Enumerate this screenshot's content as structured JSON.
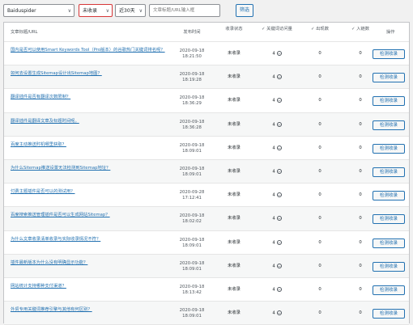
{
  "filters": {
    "spider": "Baiduspider",
    "status": "未收录",
    "period": "近30天",
    "search_placeholder": "文章标题/URL输入框",
    "filter_label": "筛选"
  },
  "table": {
    "headers": {
      "title": "文章标题/URL",
      "date": "发布时间",
      "status": "收录状态",
      "keywords": "✓ 关键词访问量",
      "hits": "✓ 出现数",
      "indexed": "✓ 入链数",
      "action": "操作"
    },
    "rows": [
      {
        "title": "国内是否可以使用Smart Keywords Tool（Pro版本）的谷歌热门关键词排名呢？",
        "date": "2020-09-18",
        "time": "18:21:50",
        "status": "未收录",
        "kw": "4",
        "hits": "0",
        "ind": "0",
        "action": "检测收录"
      },
      {
        "title": "如何去设置生成Sitemap设计出Sitemap地图？",
        "date": "2020-09-18",
        "time": "18:19:28",
        "status": "未收录",
        "kw": "4",
        "hits": "0",
        "ind": "0",
        "action": "检测收录"
      },
      {
        "title": "翻译插件是否有翻译次数限制？",
        "date": "2020-09-18",
        "time": "18:36:29",
        "status": "未收录",
        "kw": "4",
        "hits": "0",
        "ind": "0",
        "action": "检测收录"
      },
      {
        "title": "翻译插件是翻译文章及标题时间呢。",
        "date": "2020-09-18",
        "time": "18:36:28",
        "status": "未收录",
        "kw": "4",
        "hits": "0",
        "ind": "0",
        "action": "检测收录"
      },
      {
        "title": "百度主动推送时机哪里获取？",
        "date": "2020-09-18",
        "time": "18:09:01",
        "status": "未收录",
        "kw": "4",
        "hits": "0",
        "ind": "0",
        "action": "检测收录"
      },
      {
        "title": "为什么Sitemap推送设置无法检测到Sitemap地址？",
        "date": "2020-09-18",
        "time": "18:09:01",
        "status": "未收录",
        "kw": "4",
        "hits": "0",
        "ind": "0",
        "action": "检测收录"
      },
      {
        "title": "付费主题插件是否可以的测试用？",
        "date": "2020-09-28",
        "time": "17:12:41",
        "status": "未收录",
        "kw": "4",
        "hits": "0",
        "ind": "0",
        "action": "检测收录"
      },
      {
        "title": "百度搜索推送管理插件是否可以生成网站Sitemap？",
        "date": "2020-09-18",
        "time": "18:02:02",
        "status": "未收录",
        "kw": "4",
        "hits": "0",
        "ind": "0",
        "action": "检测收录"
      },
      {
        "title": "为什么文章收录清单收录与实际收录情况不符？",
        "date": "2020-09-18",
        "time": "18:09:01",
        "status": "未收录",
        "kw": "4",
        "hits": "0",
        "ind": "0",
        "action": "检测收录"
      },
      {
        "title": "插件最新版本为什么没有明确显示功能？",
        "date": "2020-09-18",
        "time": "18:09:01",
        "status": "未收录",
        "kw": "4",
        "hits": "0",
        "ind": "0",
        "action": "检测收录"
      },
      {
        "title": "网站统计支持哪种支付渠道？",
        "date": "2020-09-18",
        "time": "18:13:42",
        "status": "未收录",
        "kw": "4",
        "hits": "0",
        "ind": "0",
        "action": "检测收录"
      },
      {
        "title": "外贸专用关键词推荐引擎与其他有何区别？",
        "date": "2020-09-18",
        "time": "18:09:01",
        "status": "未收录",
        "kw": "4",
        "hits": "0",
        "ind": "0",
        "action": "检测收录"
      }
    ]
  }
}
